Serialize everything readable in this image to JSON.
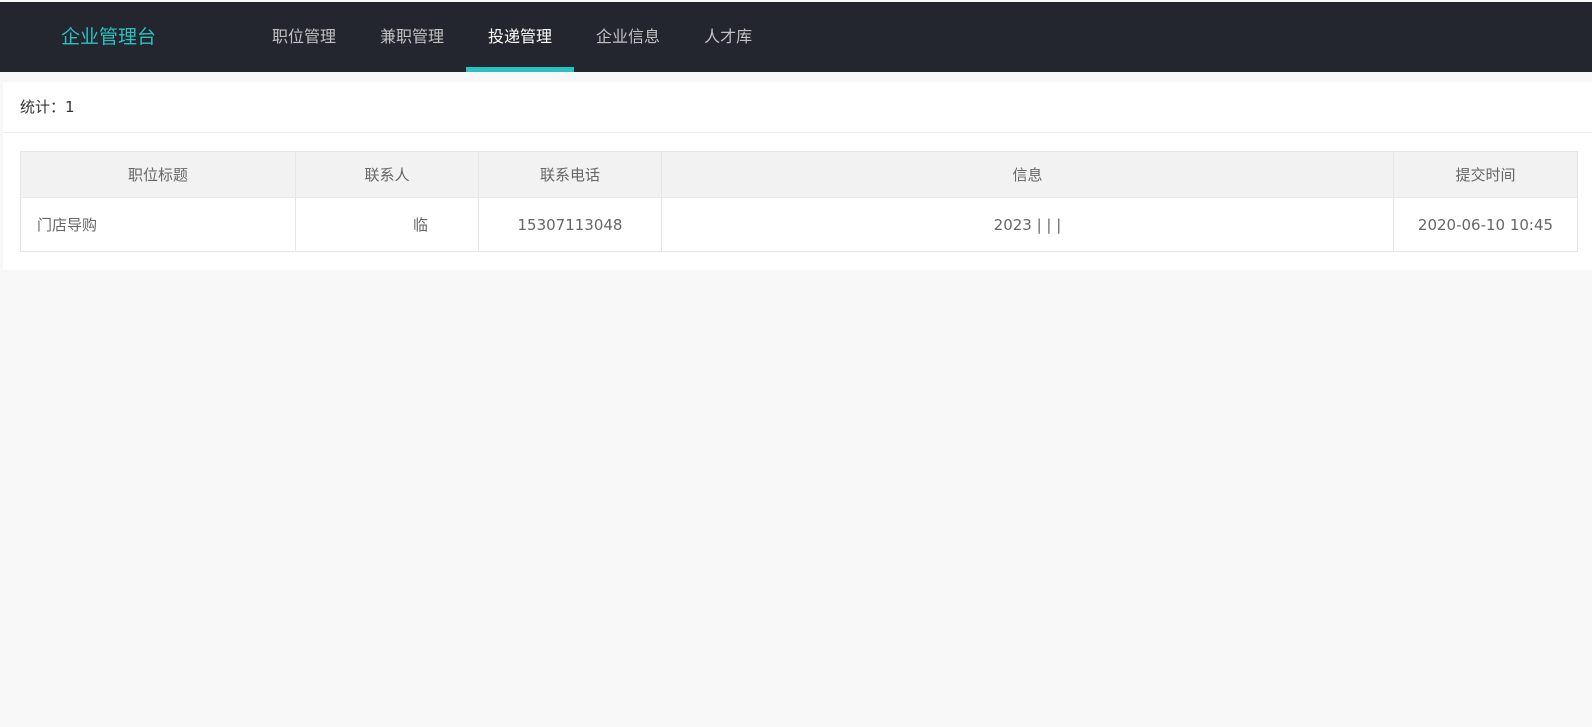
{
  "header": {
    "logo": "企业管理台",
    "nav": [
      {
        "label": "职位管理",
        "active": false
      },
      {
        "label": "兼职管理",
        "active": false
      },
      {
        "label": "投递管理",
        "active": true
      },
      {
        "label": "企业信息",
        "active": false
      },
      {
        "label": "人才库",
        "active": false
      }
    ],
    "accent_color": "#2bc0c2",
    "bar_color": "#23262e"
  },
  "summary": {
    "label": "统计：",
    "count": "1"
  },
  "table": {
    "columns": [
      "职位标题",
      "联系人",
      "联系电话",
      "信息",
      "提交时间"
    ],
    "rows": [
      [
        "门店导购",
        "临",
        "15307113048",
        "2023 | | |",
        "2020-06-10 10:45"
      ]
    ]
  }
}
